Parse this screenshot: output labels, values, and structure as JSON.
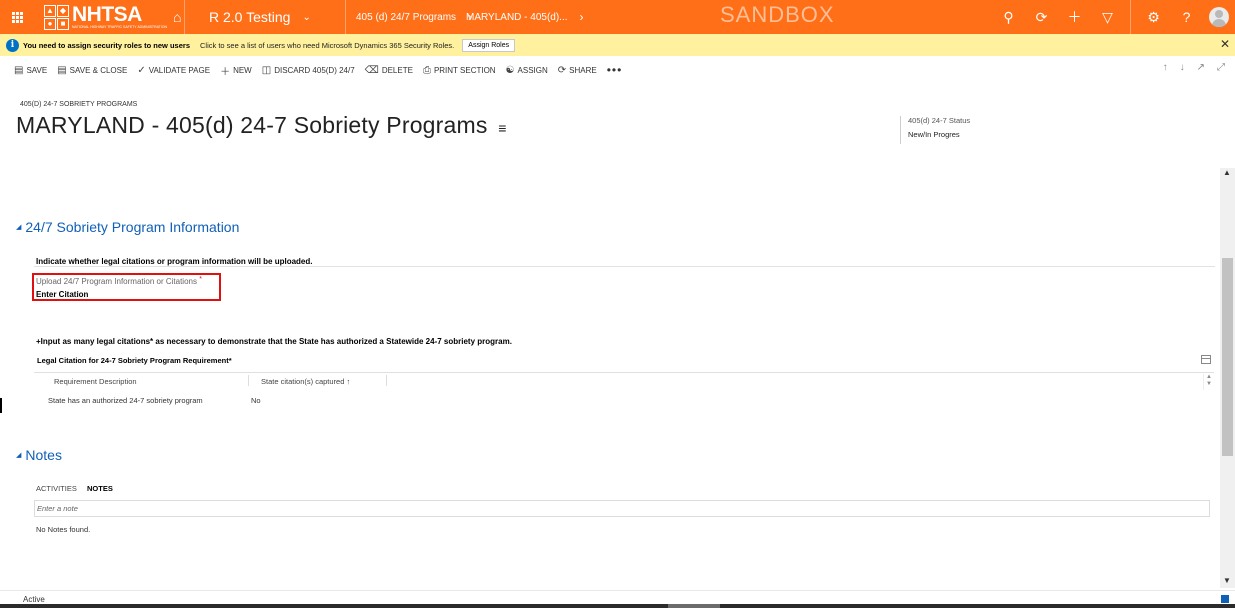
{
  "nav": {
    "logo_text": "NHTSA",
    "logo_subtext": "NATIONAL HIGHWAY TRAFFIC SAFETY ADMINISTRATION",
    "app_name": "R 2.0 Testing",
    "breadcrumb_1": "405 (d) 24/7 Programs",
    "breadcrumb_2": "MARYLAND - 405(d)...",
    "environment_label": "SANDBOX",
    "icons": [
      "waffle-icon",
      "home-icon",
      "search-icon",
      "history-icon",
      "plus-icon",
      "filter-icon",
      "gear-icon",
      "help-icon",
      "avatar"
    ]
  },
  "notification": {
    "title": "You need to assign security roles to new users",
    "text": "Click to see a list of users who need Microsoft Dynamics 365 Security Roles.",
    "button": "Assign Roles"
  },
  "commands": {
    "save": "SAVE",
    "save_close": "SAVE & CLOSE",
    "validate": "VALIDATE PAGE",
    "new": "NEW",
    "discard": "DISCARD 405(D) 24/7",
    "delete": "DELETE",
    "print": "PRINT SECTION",
    "assign": "ASSIGN",
    "share": "SHARE"
  },
  "header": {
    "entity_type": "405(D) 24-7 SOBRIETY PROGRAMS",
    "title": "MARYLAND - 405(d) 24-7 Sobriety Programs",
    "status_label": "405(d) 24-7 Status",
    "status_value": "New/In Progres"
  },
  "section_info": {
    "title": "24/7 Sobriety Program Information",
    "instruction": "Indicate whether legal citations or program information will be uploaded.",
    "field_label": "Upload 24/7 Program Information or Citations",
    "field_required_mark": "*",
    "field_value": "Enter Citation",
    "instruction2": "+Input as many legal citations* as necessary to demonstrate that the State has authorized a Statewide 24-7 sobriety program.",
    "grid_title": "Legal Citation for 24-7 Sobriety Program Requirement*",
    "columns": [
      "Requirement Description",
      "State citation(s) captured ↑"
    ],
    "rows": [
      [
        "State has an authorized 24-7 sobriety program",
        "No"
      ]
    ]
  },
  "section_notes": {
    "title": "Notes",
    "tab_activities": "ACTIVITIES",
    "tab_notes": "NOTES",
    "note_placeholder": "Enter a note",
    "empty_text": "No Notes found."
  },
  "footer": {
    "status": "Active"
  },
  "colors": {
    "nav_orange": "#ff6f17",
    "notification_yellow": "#fff19d",
    "section_blue": "#1160b7",
    "required_red": "#e01010"
  }
}
